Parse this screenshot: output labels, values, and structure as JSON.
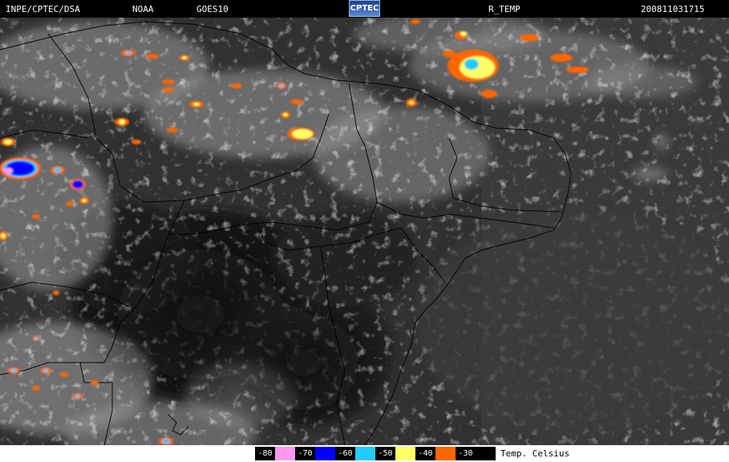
{
  "header": {
    "institution": "INPE/CPTEC/DSA",
    "agency": "NOAA",
    "satellite": "GOES10",
    "logo_text": "CPTEC",
    "product": "R_TEMP",
    "timestamp": "200811031715"
  },
  "legend": {
    "entries": [
      {
        "label": "-80",
        "color": "#ff99ee"
      },
      {
        "label": "-70",
        "color": "#0000ff"
      },
      {
        "label": "-60",
        "color": "#22ccff"
      },
      {
        "label": "-50",
        "color": "#ffff66"
      },
      {
        "label": "-40",
        "color": "#ff6600"
      },
      {
        "label": "-30",
        "color": "#000000"
      }
    ],
    "title": "Temp. Celsius"
  }
}
